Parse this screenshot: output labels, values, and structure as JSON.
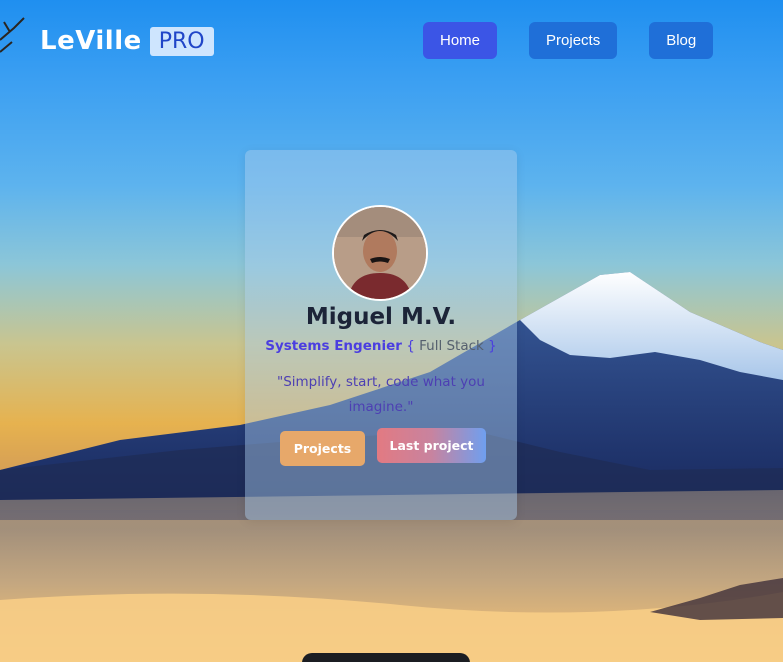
{
  "brand": {
    "name": "LeVille",
    "badge": "PRO"
  },
  "nav": {
    "items": [
      {
        "label": "Home",
        "active": true
      },
      {
        "label": "Projects",
        "active": false
      },
      {
        "label": "Blog",
        "active": false
      }
    ]
  },
  "profile": {
    "name": "Miguel M.V.",
    "role_title": "Systems Engenier",
    "role_open": "{",
    "role_stack": "Full Stack",
    "role_close": "}",
    "quote": "\"Simplify, start, code what you imagine.\"",
    "buttons": {
      "projects": "Projects",
      "last_project": "Last project"
    }
  },
  "colors": {
    "nav_active": "#3b55e6",
    "nav_button": "#1f6fd8",
    "role_accent": "#4b3ee0",
    "projects_button": "#e7a86a"
  }
}
